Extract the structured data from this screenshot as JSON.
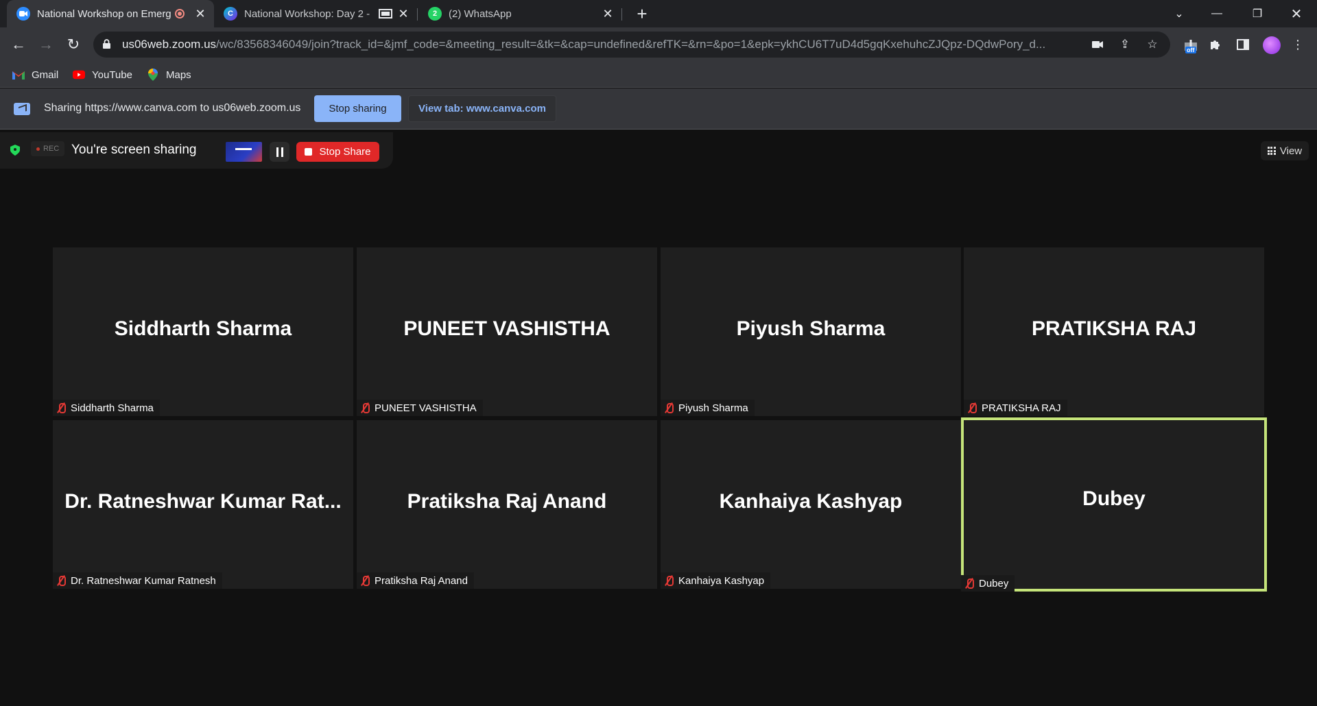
{
  "browser": {
    "tabs": [
      {
        "title": "National Workshop on Emerg",
        "favicon": "zoom-icon",
        "recording": true
      },
      {
        "title": "National Workshop: Day 2 - ",
        "favicon": "canva-icon",
        "casting": true
      },
      {
        "title": "(2) WhatsApp",
        "favicon": "whatsapp-icon"
      }
    ],
    "url_host": "us06web.zoom.us",
    "url_path": "/wc/83568346049/join?track_id=&jmf_code=&meeting_result=&tk=&cap=undefined&refTK=&rn=&po=1&epk=ykhCU6T7uD4d5gqKxehuhcZJQpz-DQdwPory_d...",
    "extension_badge": "off",
    "bookmarks": [
      "Gmail",
      "YouTube",
      "Maps"
    ]
  },
  "share_bar": {
    "text": "Sharing https://www.canva.com to us06web.zoom.us",
    "stop_label": "Stop sharing",
    "view_tab_label": "View tab: www.canva.com"
  },
  "zoom": {
    "rec_label": "REC",
    "screen_sharing_text": "You're screen sharing",
    "stop_share_label": "Stop Share",
    "view_label": "View",
    "active_speaker_color": "#c5e47a",
    "participants": [
      {
        "display": "Siddharth Sharma",
        "tag": "Siddharth Sharma"
      },
      {
        "display": "PUNEET VASHISTHA",
        "tag": "PUNEET VASHISTHA"
      },
      {
        "display": "Piyush Sharma",
        "tag": "Piyush Sharma"
      },
      {
        "display": "PRATIKSHA RAJ",
        "tag": "PRATIKSHA RAJ"
      },
      {
        "display": "Dr. Ratneshwar Kumar Rat...",
        "tag": "Dr. Ratneshwar Kumar Ratnesh"
      },
      {
        "display": "Pratiksha Raj Anand",
        "tag": "Pratiksha Raj Anand"
      },
      {
        "display": "Kanhaiya Kashyap",
        "tag": "Kanhaiya Kashyap"
      },
      {
        "display": "Dubey",
        "tag": "Dubey",
        "active": true
      }
    ]
  }
}
